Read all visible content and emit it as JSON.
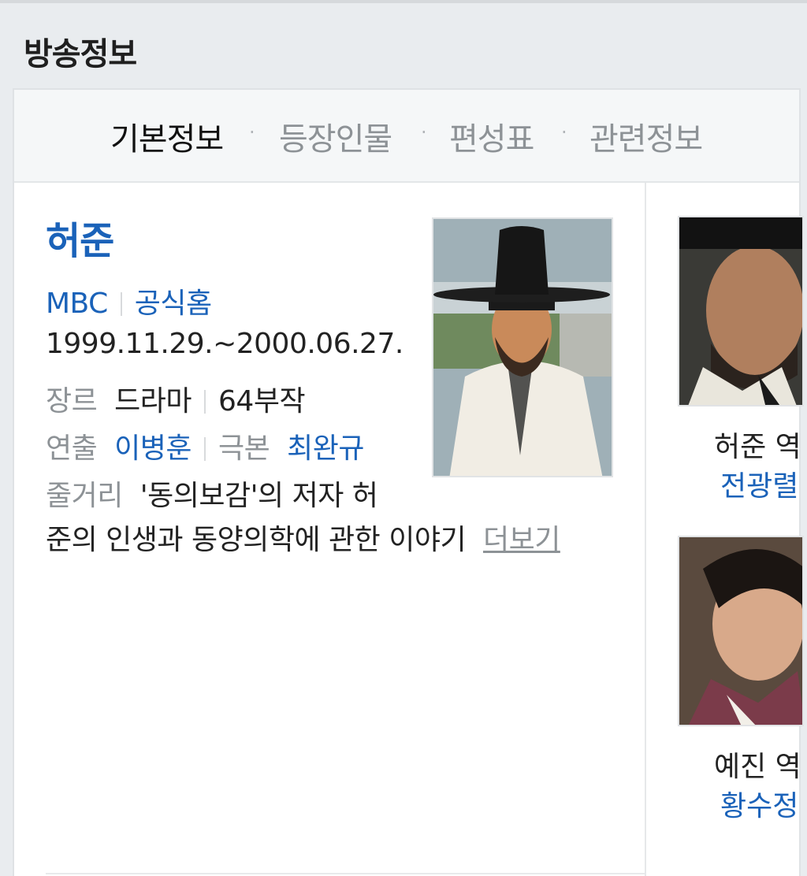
{
  "section_title": "방송정보",
  "tabs": [
    {
      "label": "기본정보",
      "active": true
    },
    {
      "label": "등장인물",
      "active": false
    },
    {
      "label": "편성표",
      "active": false
    },
    {
      "label": "관련정보",
      "active": false
    }
  ],
  "tab_separator": "·",
  "show": {
    "title": "허준",
    "channel": "MBC",
    "homepage_link": "공식홈",
    "air_period": "1999.11.29.~2000.06.27.",
    "genre_label": "장르",
    "genre": "드라마",
    "episodes": "64부작",
    "director_label": "연출",
    "director": "이병훈",
    "writer_label": "극본",
    "writer": "최완규",
    "synopsis_label": "줄거리",
    "synopsis_line1": "'동의보감'의 저자 허",
    "synopsis_line2": "준의 인생과 동양의학에 관한 이야기",
    "more_link": "더보기"
  },
  "cast": [
    {
      "role": "허준 역",
      "actor": "전광렬"
    },
    {
      "role": "예진 역",
      "actor": "황수정"
    }
  ],
  "colors": {
    "link_blue": "#1a62b9",
    "label_gray": "#8d9296",
    "page_bg": "#e9ecef"
  }
}
